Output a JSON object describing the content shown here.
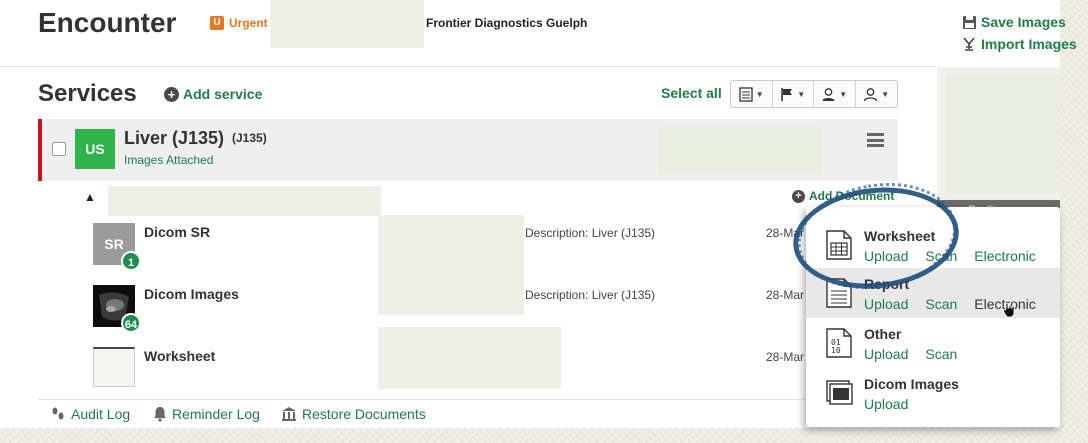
{
  "header": {
    "title": "Encounter",
    "urgent_badge": "U",
    "urgent_label": "Urgent",
    "organization": "Frontier Diagnostics Guelph",
    "save_images": "Save Images",
    "import_images": "Import Images",
    "side_bar_text": "Profile"
  },
  "services": {
    "title": "Services",
    "add_service": "Add service",
    "select_all": "Select all",
    "toolbar_icons": [
      "document-icon",
      "flag-icon",
      "physician-icon",
      "user-icon"
    ]
  },
  "service": {
    "modality": "US",
    "name": "Liver (J135)",
    "code": "(J135)",
    "status": "Images Attached"
  },
  "documents": {
    "add_document": "Add Document",
    "items": [
      {
        "thumb": "SR",
        "title": "Dicom SR",
        "count": "1",
        "description": "Description: Liver (J135)",
        "date": "28-Mar"
      },
      {
        "thumb": "",
        "title": "Dicom Images",
        "count": "64",
        "description": "Description: Liver (J135)",
        "date": "28-Mar"
      },
      {
        "thumb": "",
        "title": "Worksheet",
        "count": "",
        "description": "",
        "date": "28-Mar"
      }
    ]
  },
  "footer": {
    "audit_log": "Audit Log",
    "reminder_log": "Reminder Log",
    "restore_documents": "Restore Documents"
  },
  "dropdown": {
    "items": [
      {
        "title": "Worksheet",
        "actions": [
          "Upload",
          "Scan",
          "Electronic"
        ]
      },
      {
        "title": "Report",
        "actions": [
          "Upload",
          "Scan",
          "Electronic"
        ]
      },
      {
        "title": "Other",
        "actions": [
          "Upload",
          "Scan"
        ]
      },
      {
        "title": "Dicom Images",
        "actions": [
          "Upload"
        ]
      }
    ]
  },
  "colors": {
    "accent_green": "#1e7e46",
    "urgent_orange": "#e87722",
    "service_red": "#c9141d",
    "us_green": "#2fb34b",
    "annotation_blue": "#1d4c7a"
  }
}
